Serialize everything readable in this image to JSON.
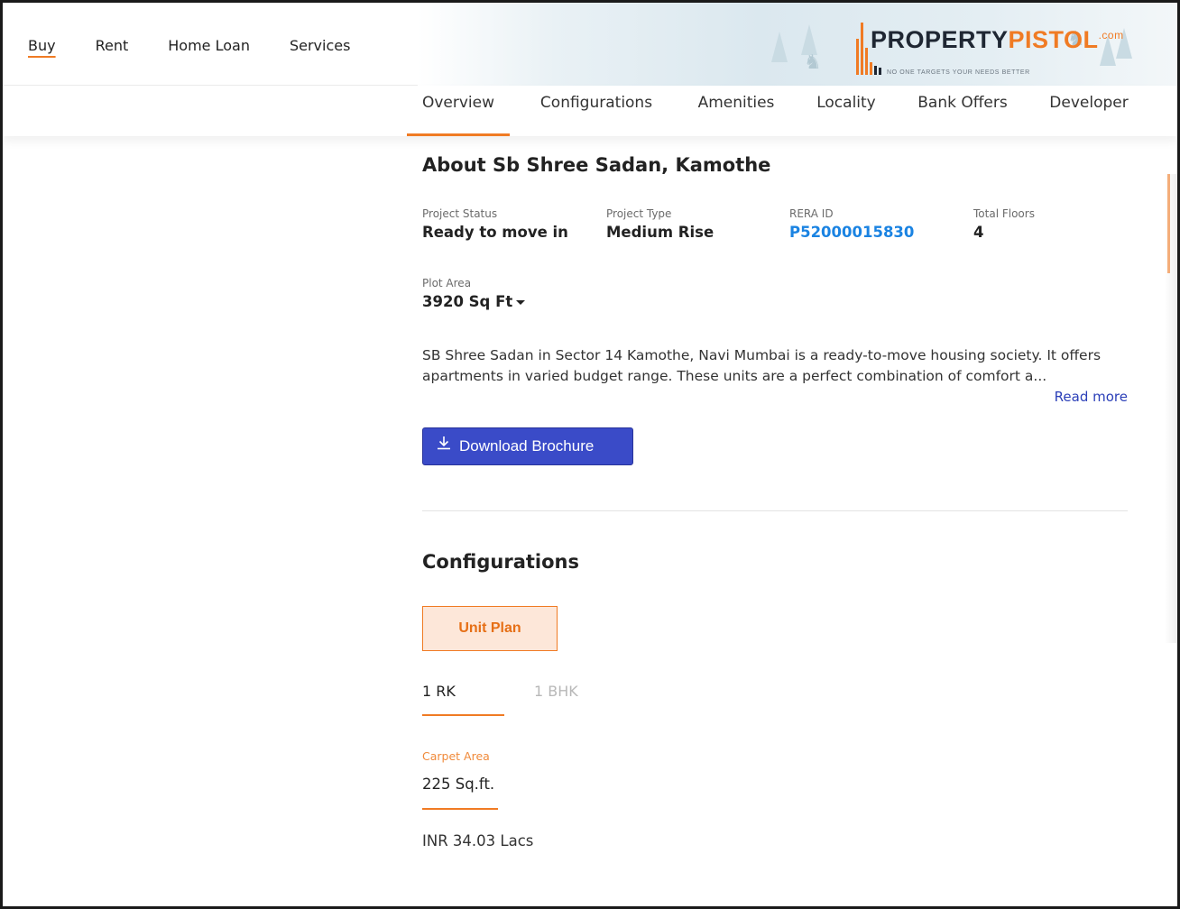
{
  "header": {
    "menu": [
      {
        "label": "Buy",
        "active": true
      },
      {
        "label": "Rent",
        "active": false
      },
      {
        "label": "Home Loan",
        "active": false
      },
      {
        "label": "Services",
        "active": false
      }
    ],
    "logo": {
      "part1": "PROPERTY",
      "part2": "PISTOL",
      "suffix": ".com",
      "tagline": "NO ONE TARGETS YOUR NEEDS BETTER"
    }
  },
  "section_tabs": [
    {
      "label": "Overview",
      "active": true
    },
    {
      "label": "Configurations",
      "active": false
    },
    {
      "label": "Amenities",
      "active": false
    },
    {
      "label": "Locality",
      "active": false
    },
    {
      "label": "Bank Offers",
      "active": false
    },
    {
      "label": "Developer",
      "active": false
    }
  ],
  "about": {
    "title": "About Sb Shree Sadan, Kamothe",
    "facts": {
      "project_status": {
        "label": "Project Status",
        "value": "Ready to move in"
      },
      "project_type": {
        "label": "Project Type",
        "value": "Medium Rise"
      },
      "rera_id": {
        "label": "RERA ID",
        "value": "P52000015830"
      },
      "total_floors": {
        "label": "Total Floors",
        "value": "4"
      },
      "plot_area": {
        "label": "Plot Area",
        "value": "3920 Sq Ft"
      }
    },
    "description_line1": "SB Shree Sadan in Sector 14 Kamothe, Navi Mumbai is a ready-to-move housing society. It offers",
    "description_line2": "apartments in varied budget range. These units are a perfect combination of comfort a...",
    "read_more": "Read more",
    "download_label": "Download Brochure"
  },
  "configurations": {
    "title": "Configurations",
    "unit_plan_label": "Unit Plan",
    "unit_tabs": [
      {
        "label": "1 RK",
        "active": true
      },
      {
        "label": "1 BHK",
        "active": false
      }
    ],
    "carpet_area_label": "Carpet Area",
    "carpet_area_value": "225 Sq.ft.",
    "price": "INR 34.03 Lacs"
  },
  "colors": {
    "accent": "#f07b24",
    "primary_button": "#3a4bc8",
    "link": "#1a83e2"
  },
  "icons": [
    "download-icon",
    "chevron-down-icon",
    "tree-icon",
    "deer-icon"
  ]
}
